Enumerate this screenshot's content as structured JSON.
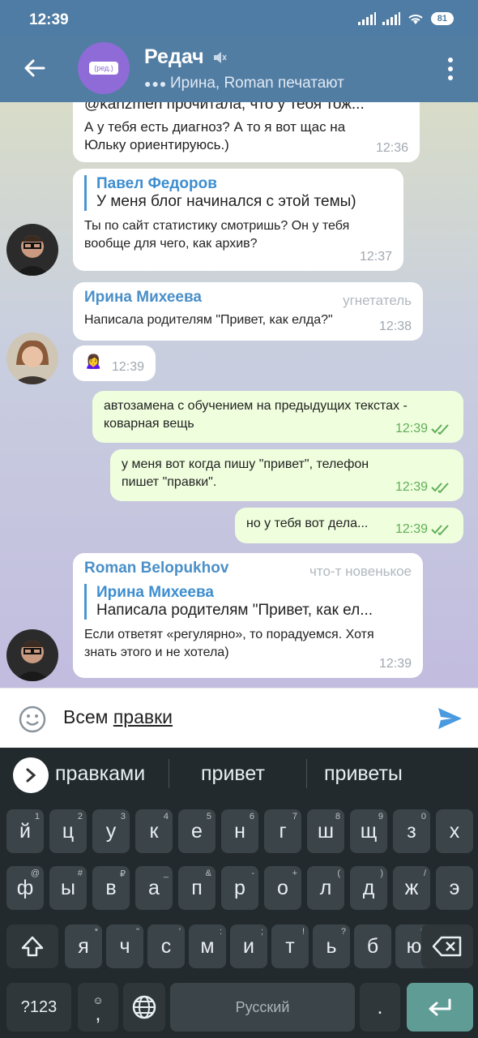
{
  "status": {
    "time": "12:39",
    "battery": "81"
  },
  "header": {
    "title": "Редач",
    "avatar_text": "(ред.)",
    "typing": "Ирина, Roman печатают"
  },
  "messages": [
    {
      "id": "m1",
      "quote_partial": "@kanzmen прочитала, что у тебя тож...",
      "text": "А у тебя есть диагноз? А то я вот щас на Юльку ориентируюсь.)",
      "time": "12:36"
    },
    {
      "id": "m2",
      "reply_name": "Павел Федоров",
      "reply_text": "У меня блог начинался с этой темы)",
      "text": "Ты по сайт статистику смотришь? Он у тебя вообще для чего, как архив?",
      "time": "12:37"
    },
    {
      "id": "m3",
      "sender": "Ирина Михеева",
      "rank": "угнетатель",
      "text": "Написала родителям \"Привет, как елда?\"",
      "time": "12:38"
    },
    {
      "id": "m4",
      "text": "🙍‍♀️",
      "time": "12:39"
    },
    {
      "id": "m5",
      "out": true,
      "text": "автозамена с обучением на предыдущих текстах - коварная вещь",
      "time": "12:39"
    },
    {
      "id": "m6",
      "out": true,
      "text": "у меня вот когда пишу \"привет\", телефон пишет \"правки\".",
      "time": "12:39"
    },
    {
      "id": "m7",
      "out": true,
      "text": "но у тебя вот дела...",
      "time": "12:39"
    },
    {
      "id": "m8",
      "sender": "Roman Belopukhov",
      "rank": "что-т новенькое",
      "reply_name": "Ирина Михеева",
      "reply_text": "Написала родителям \"Привет, как ел...",
      "text": "Если ответят «регулярно», то порадуемся. Хотя знать этого и не хотела)",
      "time": "12:39"
    }
  ],
  "input": {
    "text_plain": "Всем ",
    "text_underlined": "правки"
  },
  "keyboard": {
    "suggestions": [
      "правками",
      "привет",
      "приветы"
    ],
    "row1": [
      [
        "й",
        "1"
      ],
      [
        "ц",
        "2"
      ],
      [
        "у",
        "3"
      ],
      [
        "к",
        "4"
      ],
      [
        "е",
        "5"
      ],
      [
        "н",
        "6"
      ],
      [
        "г",
        "7"
      ],
      [
        "ш",
        "8"
      ],
      [
        "щ",
        "9"
      ],
      [
        "з",
        "0"
      ],
      [
        "х",
        ""
      ]
    ],
    "row2": [
      [
        "ф",
        "@"
      ],
      [
        "ы",
        "#"
      ],
      [
        "в",
        "₽"
      ],
      [
        "а",
        "_"
      ],
      [
        "п",
        "&"
      ],
      [
        "р",
        "-"
      ],
      [
        "о",
        "+"
      ],
      [
        "л",
        "("
      ],
      [
        "д",
        ")"
      ],
      [
        "ж",
        "/"
      ],
      [
        "э",
        ""
      ]
    ],
    "row3": [
      [
        "я",
        "*"
      ],
      [
        "ч",
        "\""
      ],
      [
        "с",
        "'"
      ],
      [
        "м",
        ":"
      ],
      [
        "и",
        ";"
      ],
      [
        "т",
        "!"
      ],
      [
        "ь",
        "?"
      ],
      [
        "б",
        ""
      ],
      [
        "ю",
        "%"
      ]
    ],
    "symbols_label": "?123",
    "comma": ",",
    "space_label": "Русский",
    "period": "."
  }
}
